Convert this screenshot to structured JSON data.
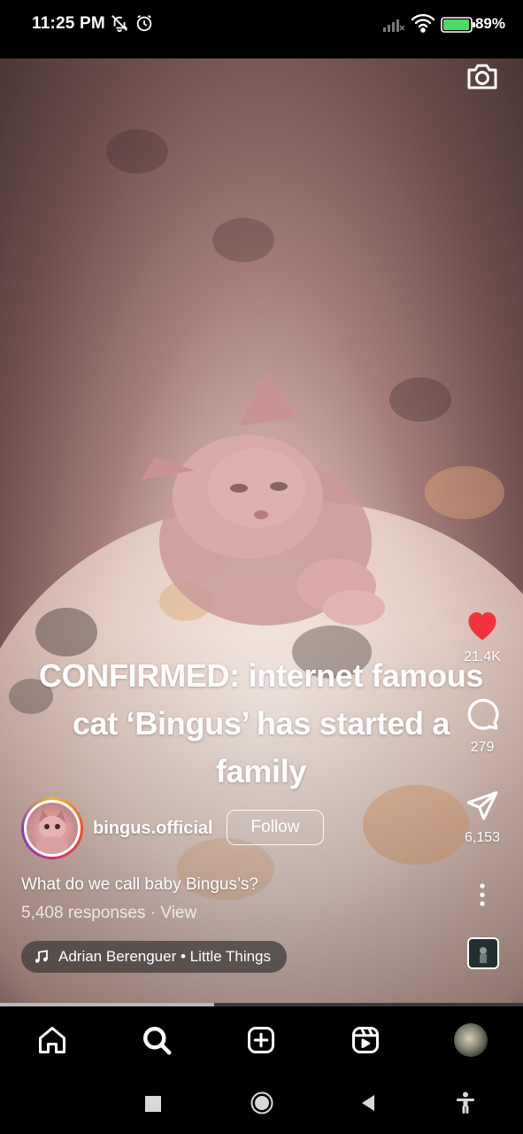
{
  "status_bar": {
    "time": "11:25 PM",
    "battery_percent_label": "89%",
    "battery_level": 0.89,
    "icons": [
      "notifications-off-icon",
      "alarm-icon",
      "signal-icon",
      "wifi-icon",
      "battery-icon"
    ]
  },
  "reel": {
    "caption": "CONFIRMED: internet famous cat ‘Bingus’ has started a family",
    "author": {
      "username": "bingus.official",
      "follow_label": "Follow"
    },
    "question": "What do we call baby Bingus’s?",
    "responses": "5,408 responses · View",
    "music": "Adrian Berenguer • Little Things",
    "actions": {
      "likes": "21.4K",
      "comments": "279",
      "shares": "6,153"
    },
    "progress_fraction": 0.41
  },
  "colors": {
    "like": "#f0333c",
    "background": "#000000",
    "text": "#ffffff"
  },
  "bottom_nav": [
    "home-icon",
    "search-icon",
    "create-icon",
    "reels-icon",
    "profile-avatar"
  ],
  "system_nav": [
    "recents-icon",
    "home-circle-icon",
    "back-icon",
    "accessibility-icon"
  ]
}
